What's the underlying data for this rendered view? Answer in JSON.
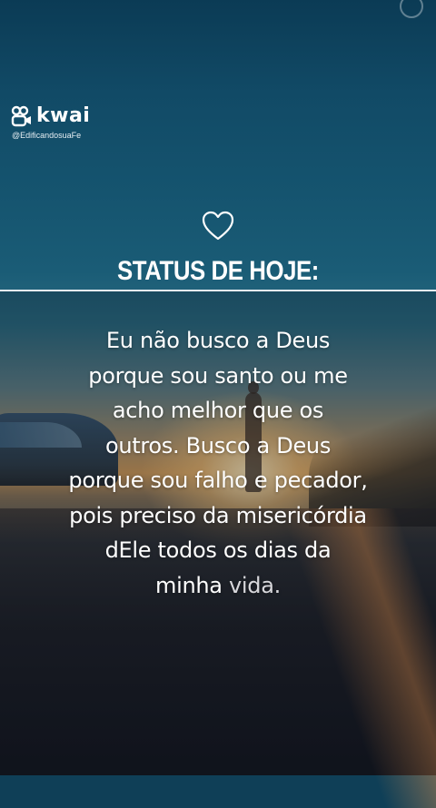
{
  "brand": {
    "name": "kwai",
    "handle": "@EdificandosuaFe"
  },
  "heart_icon": "heart-outline-icon",
  "post": {
    "title": "STATUS DE HOJE:",
    "quote_lines": [
      "Eu não busco a Deus",
      "porque sou santo ou me",
      "acho melhor que os",
      "outros. Busco a Deus",
      "porque sou falho e pecador,",
      "pois preciso da misericórdia",
      "dEle todos os dias da"
    ],
    "quote_last_a": "minha ",
    "quote_last_b": "vida."
  },
  "colors": {
    "sky_top": "#0b3b55",
    "sunset": "#d09a58",
    "text": "#ffffff"
  }
}
